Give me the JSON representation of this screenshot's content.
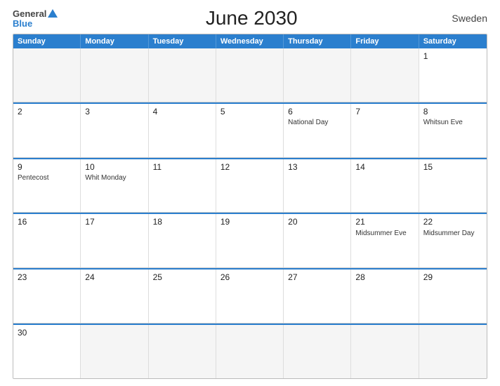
{
  "header": {
    "logo_general": "General",
    "logo_blue": "Blue",
    "title": "June 2030",
    "country": "Sweden"
  },
  "days_of_week": [
    "Sunday",
    "Monday",
    "Tuesday",
    "Wednesday",
    "Thursday",
    "Friday",
    "Saturday"
  ],
  "weeks": [
    [
      {
        "day": "",
        "event": "",
        "empty": true
      },
      {
        "day": "",
        "event": "",
        "empty": true
      },
      {
        "day": "",
        "event": "",
        "empty": true
      },
      {
        "day": "",
        "event": "",
        "empty": true
      },
      {
        "day": "",
        "event": "",
        "empty": true
      },
      {
        "day": "",
        "event": "",
        "empty": true
      },
      {
        "day": "1",
        "event": ""
      }
    ],
    [
      {
        "day": "2",
        "event": ""
      },
      {
        "day": "3",
        "event": ""
      },
      {
        "day": "4",
        "event": ""
      },
      {
        "day": "5",
        "event": ""
      },
      {
        "day": "6",
        "event": "National Day"
      },
      {
        "day": "7",
        "event": ""
      },
      {
        "day": "8",
        "event": "Whitsun Eve"
      }
    ],
    [
      {
        "day": "9",
        "event": "Pentecost"
      },
      {
        "day": "10",
        "event": "Whit Monday"
      },
      {
        "day": "11",
        "event": ""
      },
      {
        "day": "12",
        "event": ""
      },
      {
        "day": "13",
        "event": ""
      },
      {
        "day": "14",
        "event": ""
      },
      {
        "day": "15",
        "event": ""
      }
    ],
    [
      {
        "day": "16",
        "event": ""
      },
      {
        "day": "17",
        "event": ""
      },
      {
        "day": "18",
        "event": ""
      },
      {
        "day": "19",
        "event": ""
      },
      {
        "day": "20",
        "event": ""
      },
      {
        "day": "21",
        "event": "Midsummer Eve"
      },
      {
        "day": "22",
        "event": "Midsummer Day"
      }
    ],
    [
      {
        "day": "23",
        "event": ""
      },
      {
        "day": "24",
        "event": ""
      },
      {
        "day": "25",
        "event": ""
      },
      {
        "day": "26",
        "event": ""
      },
      {
        "day": "27",
        "event": ""
      },
      {
        "day": "28",
        "event": ""
      },
      {
        "day": "29",
        "event": ""
      }
    ],
    [
      {
        "day": "30",
        "event": ""
      },
      {
        "day": "",
        "event": "",
        "empty": true
      },
      {
        "day": "",
        "event": "",
        "empty": true
      },
      {
        "day": "",
        "event": "",
        "empty": true
      },
      {
        "day": "",
        "event": "",
        "empty": true
      },
      {
        "day": "",
        "event": "",
        "empty": true
      },
      {
        "day": "",
        "event": "",
        "empty": true
      }
    ]
  ]
}
